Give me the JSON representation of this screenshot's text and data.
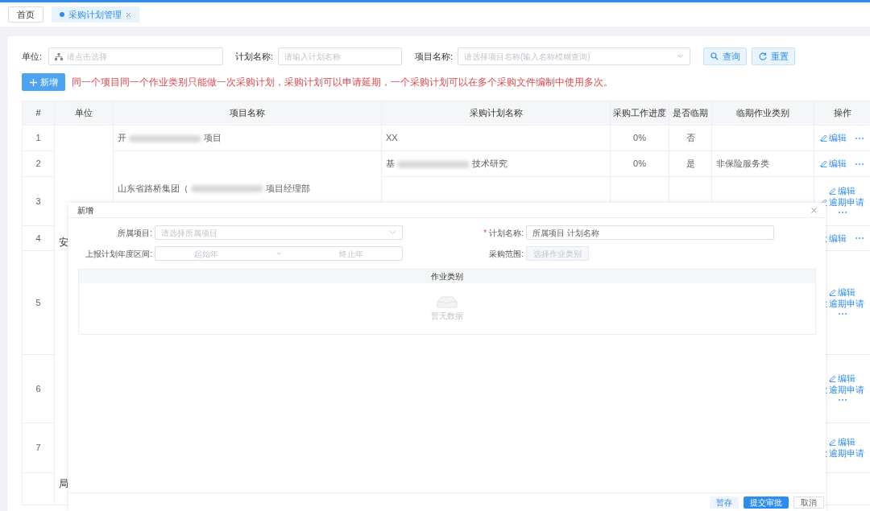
{
  "tabs": [
    {
      "label": "首页",
      "selected": false,
      "closable": false
    },
    {
      "label": "采购计划管理",
      "selected": true,
      "closable": true
    }
  ],
  "filters": [
    {
      "kind": "tree",
      "label": "单位:",
      "placeholder": "请点击选择"
    },
    {
      "kind": "text",
      "label": "计划名称:",
      "placeholder": "请输入计划名称"
    },
    {
      "kind": "select",
      "label": "项目名称:",
      "placeholder": "请选择项目名称(输入名称模糊查询)"
    }
  ],
  "search_buttons": [
    {
      "kind": "query",
      "label": "查询"
    },
    {
      "kind": "reset",
      "label": "重置"
    }
  ],
  "add_button": "新增",
  "notice": "同一个项目同一个作业类别只能做一次采购计划，采购计划可以申请延期，一个采购计划可以在多个采购文件编制中使用多次。",
  "table": {
    "columns": [
      "#",
      "单位",
      "项目名称",
      "采购计划名称",
      "采购工作进度",
      "是否临期",
      "临期作业类别",
      "操作"
    ],
    "unit_cell": {
      "text_top": "安",
      "text_bottom": "局"
    },
    "rows": [
      {
        "index": "1",
        "project": {
          "prefix": "开",
          "suffix": "项目"
        },
        "plan": {
          "text": "XX"
        },
        "progress": "0%",
        "overdue": "否",
        "actions": [
          {
            "kind": "edit",
            "label": "编辑"
          },
          {
            "kind": "more",
            "label": "⋯"
          }
        ]
      },
      {
        "index": "2",
        "project": {
          "prefix": "山东省路桥集团（",
          "suffix": "项目经理部"
        },
        "plan": {
          "prefix": "基",
          "suffix": "技术研究"
        },
        "progress": "0%",
        "overdue": "是",
        "category": "非保险服务类",
        "actions": [
          {
            "kind": "edit",
            "label": "编辑"
          },
          {
            "kind": "more",
            "label": "⋯"
          }
        ]
      },
      {
        "index": "3",
        "actions": [
          {
            "kind": "edit",
            "label": "编辑"
          },
          {
            "kind": "extend",
            "label": "逾期申请"
          },
          {
            "kind": "more",
            "label": "⋯"
          }
        ]
      },
      {
        "index": "4",
        "actions": [
          {
            "kind": "edit",
            "label": "编辑"
          },
          {
            "kind": "more",
            "label": "⋯"
          }
        ]
      },
      {
        "index": "5",
        "actions": [
          {
            "kind": "edit",
            "label": "编辑"
          },
          {
            "kind": "extend",
            "label": "逾期申请"
          },
          {
            "kind": "more",
            "label": "⋯"
          }
        ]
      },
      {
        "index": "6",
        "actions": [
          {
            "kind": "edit",
            "label": "编辑"
          },
          {
            "kind": "extend",
            "label": "逾期申请"
          },
          {
            "kind": "more",
            "label": "⋯"
          }
        ]
      },
      {
        "index": "7",
        "actions": [
          {
            "kind": "edit",
            "label": "编辑"
          },
          {
            "kind": "extend",
            "label": "逾期申请"
          }
        ]
      }
    ]
  },
  "dialog": {
    "title": "新增",
    "required_mark": "*",
    "fields": [
      {
        "kind": "select",
        "label": "所属项目:",
        "placeholder": "请选择所属项目",
        "required": false
      },
      {
        "kind": "text",
        "label": "计划名称:",
        "value": "所属项目 计划名称",
        "required": true
      },
      {
        "kind": "range",
        "label": "上报计划年度区间:",
        "start_placeholder": "起始年",
        "separator": "~",
        "end_placeholder": "终止年",
        "required": false
      },
      {
        "kind": "button",
        "label": "采购范围:",
        "button": "选择作业类别",
        "required": false
      }
    ],
    "grid": {
      "columns": [
        "作业类别"
      ],
      "empty_text": "暂无数据"
    },
    "footer": [
      {
        "kind": "secondary",
        "label": "暂存"
      },
      {
        "kind": "primary",
        "label": "提交审批"
      },
      {
        "kind": "default",
        "label": "取消"
      }
    ]
  }
}
